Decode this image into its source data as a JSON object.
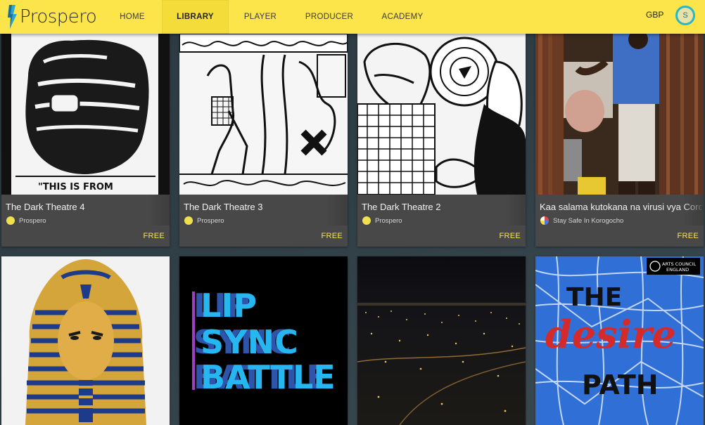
{
  "app": {
    "name": "Prospero"
  },
  "nav": {
    "items": [
      {
        "label": "HOME"
      },
      {
        "label": "LIBRARY",
        "active": true
      },
      {
        "label": "PLAYER"
      },
      {
        "label": "PRODUCER"
      },
      {
        "label": "ACADEMY"
      }
    ],
    "currency": "GBP",
    "avatar_initial": "S"
  },
  "colors": {
    "brand_yellow": "#fbe54a",
    "card_bg": "#484848",
    "price": "#fbe54a",
    "avatar_ring": "#2bb6c6"
  },
  "cards": [
    {
      "title": "The Dark Theatre 4",
      "author": "Prospero",
      "price": "FREE",
      "thumb_caption": "\"THIS IS FROM"
    },
    {
      "title": "The Dark Theatre 3",
      "author": "Prospero",
      "price": "FREE"
    },
    {
      "title": "The Dark Theatre 2",
      "author": "Prospero",
      "price": "FREE"
    },
    {
      "title": "Kaa salama kutokana na virusi vya Corona",
      "author": "Stay Safe In Korogocho",
      "price": "FREE"
    },
    {
      "title": "",
      "thumb": "tutankhamun-mask"
    },
    {
      "title": "",
      "thumb_text": [
        "LIP",
        "SYNC",
        "BATTLE"
      ]
    },
    {
      "title": "",
      "thumb": "city-night-aerial"
    },
    {
      "title": "",
      "thumb_text": [
        "THE",
        "desire",
        "PATH"
      ],
      "badge_lines": [
        "ARTS COUNCIL",
        "ENGLAND"
      ]
    }
  ]
}
